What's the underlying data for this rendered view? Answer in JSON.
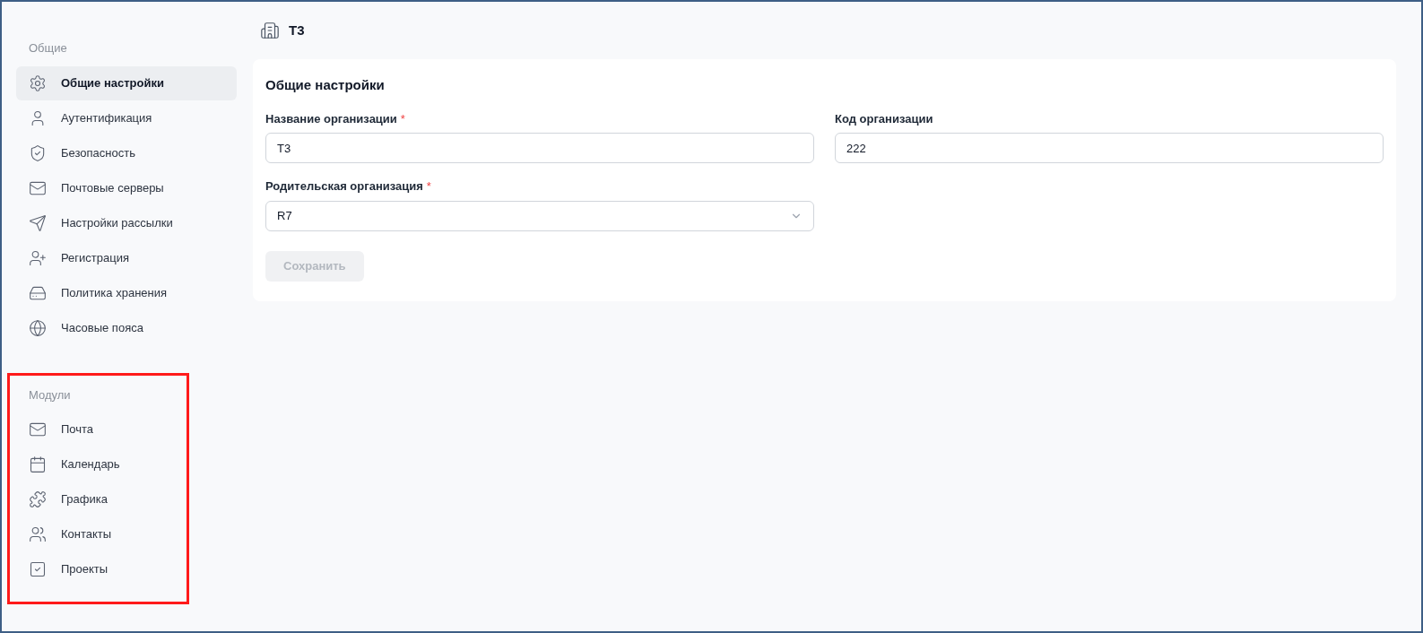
{
  "sidebar": {
    "sections": [
      {
        "title": "Общие",
        "highlighted": false,
        "items": [
          {
            "label": "Общие настройки",
            "selected": true
          },
          {
            "label": "Аутентификация",
            "selected": false
          },
          {
            "label": "Безопасность",
            "selected": false
          },
          {
            "label": "Почтовые серверы",
            "selected": false
          },
          {
            "label": "Настройки рассылки",
            "selected": false
          },
          {
            "label": "Регистрация",
            "selected": false
          },
          {
            "label": "Политика хранения",
            "selected": false
          },
          {
            "label": "Часовые пояса",
            "selected": false
          }
        ]
      },
      {
        "title": "Модули",
        "highlighted": true,
        "items": [
          {
            "label": "Почта",
            "selected": false
          },
          {
            "label": "Календарь",
            "selected": false
          },
          {
            "label": "Графика",
            "selected": false
          },
          {
            "label": "Контакты",
            "selected": false
          },
          {
            "label": "Проекты",
            "selected": false
          }
        ]
      }
    ]
  },
  "header": {
    "title": "Т3"
  },
  "card": {
    "title": "Общие настройки",
    "fields": [
      {
        "kind": "text",
        "label": "Название организации",
        "required_mark": "*",
        "value": "Т3"
      },
      {
        "kind": "text",
        "label": "Код организации",
        "value": "222"
      },
      {
        "kind": "select",
        "label": "Родительская организация",
        "required_mark": "*",
        "value": "R7"
      }
    ],
    "save_button": {
      "label": "Сохранить",
      "disabled": true
    }
  }
}
